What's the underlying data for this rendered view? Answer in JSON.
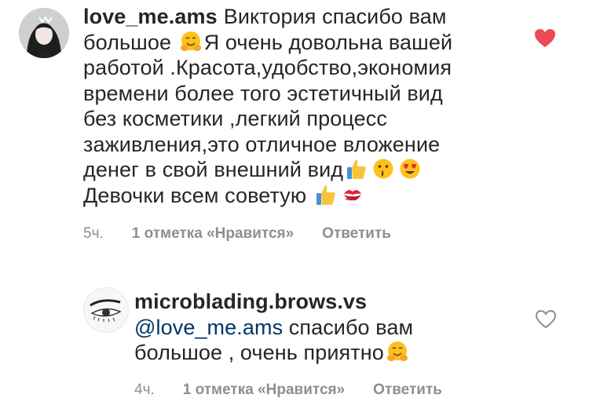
{
  "comments": [
    {
      "username": "love_me.ams",
      "line1": "Виктория спасибо вам",
      "line2a": "большое ",
      "line2b": "Я очень довольна вашей",
      "line3": "работой .Красота,удобство,экономия",
      "line4": "времени более того эстетичный вид",
      "line5": "без косметики ,легкий процесс",
      "line6": "заживления,это отличное вложение",
      "line7": "денег в свой внешний вид",
      "line8": "Девочки всем советую ",
      "time": "5ч.",
      "likes": "1 отметка «Нравится»",
      "reply": "Ответить",
      "liked": true,
      "heart_icon": "heart-filled-icon",
      "heart_color": "#ed4956"
    },
    {
      "username": "microblading.brows.vs",
      "mention": "@love_me.ams",
      "text_a": " спасибо вам",
      "text_b": "большое , очень приятно",
      "time": "4ч.",
      "likes": "1 отметка «Нравится»",
      "reply": "Ответить",
      "liked": false,
      "heart_icon": "heart-outline-icon",
      "heart_color": "#8e8e8e"
    }
  ],
  "colors": {
    "text": "#262626",
    "meta": "#8e8e8e",
    "mention": "#003569"
  }
}
